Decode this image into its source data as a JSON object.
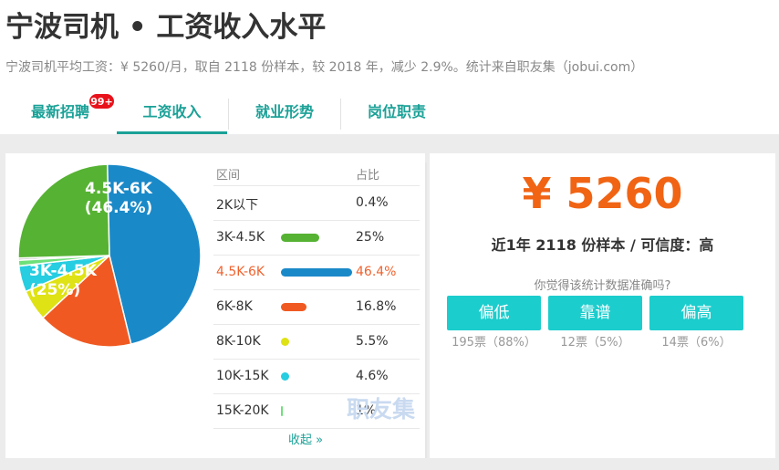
{
  "header": {
    "title": "宁波司机 • 工资收入水平",
    "summary": "宁波司机平均工资：¥ 5260/月，取自 2118 份样本，较 2018 年，减少 2.9%。统计来自职友集（jobui.com）"
  },
  "tabs": [
    {
      "label": "最新招聘",
      "badge": "99+"
    },
    {
      "label": "工资收入",
      "active": true
    },
    {
      "label": "就业形势"
    },
    {
      "label": "岗位职责"
    }
  ],
  "distribution": {
    "headers": {
      "range": "区间",
      "share": "占比"
    },
    "rows": [
      {
        "range": "2K以下",
        "pct": "0.4%",
        "value": 0.4,
        "color": "#bbbbbb"
      },
      {
        "range": "3K-4.5K",
        "pct": "25%",
        "value": 25,
        "color": "#56b233"
      },
      {
        "range": "4.5K-6K",
        "pct": "46.4%",
        "value": 46.4,
        "color": "#1a89c8"
      },
      {
        "range": "6K-8K",
        "pct": "16.8%",
        "value": 16.8,
        "color": "#f05a22"
      },
      {
        "range": "8K-10K",
        "pct": "5.5%",
        "value": 5.5,
        "color": "#dfe214"
      },
      {
        "range": "10K-15K",
        "pct": "4.6%",
        "value": 4.6,
        "color": "#27cde0"
      },
      {
        "range": "15K-20K",
        "pct": "1%",
        "value": 1,
        "color": "#6ee07a"
      }
    ],
    "highlight_index": 2,
    "collapse_label": "收起 »",
    "watermark": "职友集"
  },
  "chart_data": {
    "type": "pie",
    "categories": [
      "2K以下",
      "3K-4.5K",
      "4.5K-6K",
      "6K-8K",
      "8K-10K",
      "10K-15K",
      "15K-20K"
    ],
    "values": [
      0.4,
      25,
      46.4,
      16.8,
      5.5,
      4.6,
      1
    ],
    "slice_labels": [
      {
        "range": "4.5K-6K",
        "pct": "(46.4%)"
      },
      {
        "range": "3K-4.5K",
        "pct": "(25%)"
      }
    ]
  },
  "stats": {
    "salary": "¥ 5260",
    "sample_line": "近1年 2118 份样本 / 可信度：高",
    "question": "你觉得该统计数据准确吗?",
    "votes": [
      {
        "label": "偏低",
        "count": "195票（88%）"
      },
      {
        "label": "靠谱",
        "count": "12票（5%）"
      },
      {
        "label": "偏高",
        "count": "14票（6%）"
      }
    ]
  },
  "colors": {
    "accent": "#1aa197",
    "highlight": "#f0632f",
    "salary": "#f06414",
    "vote_button": "#1ccdcd"
  }
}
